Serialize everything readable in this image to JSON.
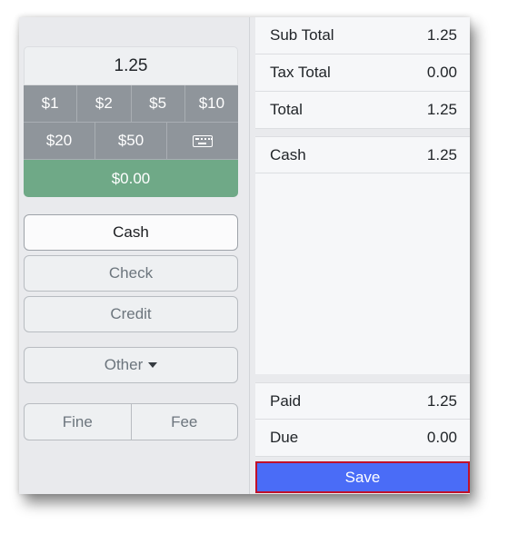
{
  "amount": {
    "value": "1.25"
  },
  "quick_amounts": {
    "row1": [
      "$1",
      "$2",
      "$5",
      "$10"
    ],
    "row2": [
      "$20",
      "$50"
    ],
    "keyboard_icon": "keyboard-icon"
  },
  "change": {
    "value": "$0.00"
  },
  "tender_types": {
    "cash": "Cash",
    "check": "Check",
    "credit": "Credit",
    "other": "Other",
    "selected": "Cash"
  },
  "adjustments": {
    "fine": "Fine",
    "fee": "Fee"
  },
  "summary": {
    "sub_total": {
      "label": "Sub Total",
      "value": "1.25"
    },
    "tax_total": {
      "label": "Tax Total",
      "value": "0.00"
    },
    "total": {
      "label": "Total",
      "value": "1.25"
    }
  },
  "payments": [
    {
      "label": "Cash",
      "value": "1.25"
    }
  ],
  "balance": {
    "paid": {
      "label": "Paid",
      "value": "1.25"
    },
    "due": {
      "label": "Due",
      "value": "0.00"
    }
  },
  "actions": {
    "save": "Save"
  },
  "colors": {
    "quick_button": "#8f959b",
    "change_bar": "#6fa987",
    "save_button": "#4a6cf7",
    "highlight_border": "#c0102a"
  }
}
